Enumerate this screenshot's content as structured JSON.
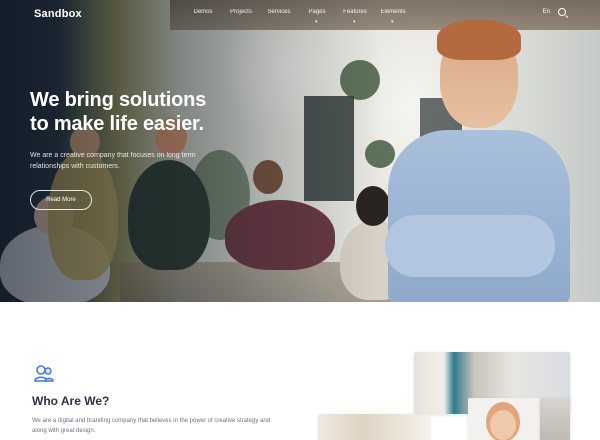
{
  "nav": {
    "logo": "Sandbox",
    "menu": [
      "Demos",
      "Projects",
      "Services",
      "Pages",
      "Features",
      "Elements"
    ],
    "lang": "En",
    "search_icon": "search-icon"
  },
  "hero": {
    "title_line1": "We bring solutions",
    "title_line2": "to make life easier.",
    "subtitle": "We are a creative company that focuses on long term relationships with customers.",
    "button": "Read More"
  },
  "about": {
    "icon": "team-icon",
    "title": "Who Are We?",
    "text": "We are a digital and branding company that believes in the power of creative strategy and along with great design."
  },
  "colors": {
    "accent": "#3f78e0",
    "heading": "#2c3347",
    "body_text": "#6a7180"
  }
}
